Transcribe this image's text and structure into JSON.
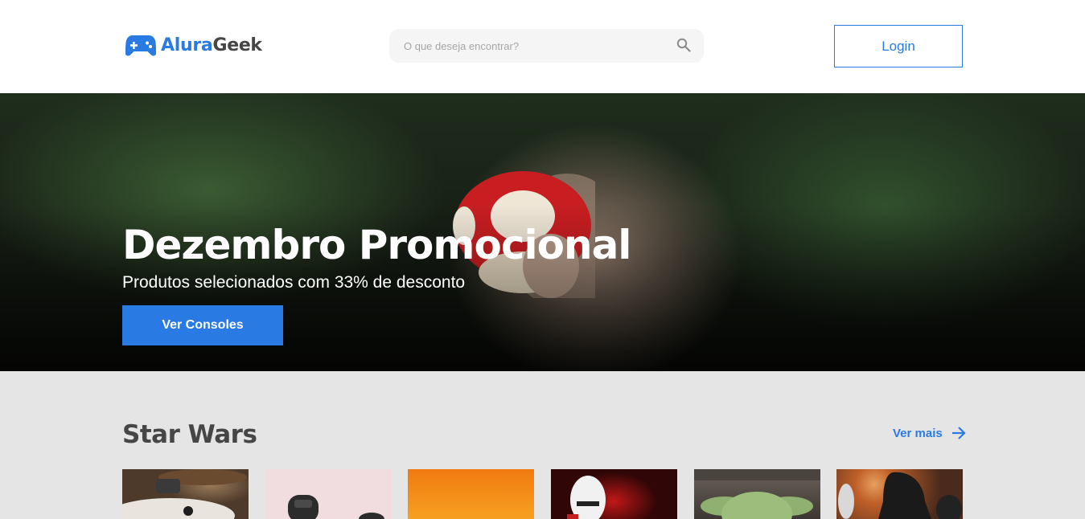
{
  "header": {
    "logo_part1": "Alura",
    "logo_part2": "Geek",
    "search_placeholder": "O que deseja encontrar?",
    "login_label": "Login"
  },
  "banner": {
    "title": "Dezembro Promocional",
    "subtitle": "Produtos selecionados com 33% de desconto",
    "button_label": "Ver Consoles"
  },
  "section": {
    "title": "Star Wars",
    "see_more_label": "Ver mais"
  },
  "colors": {
    "accent": "#2a7ae4",
    "text_dark": "#464646",
    "section_bg": "#e5e5e5"
  },
  "icons": {
    "logo": "gamepad-icon",
    "search": "search-icon",
    "see_more": "arrow-right-icon"
  }
}
